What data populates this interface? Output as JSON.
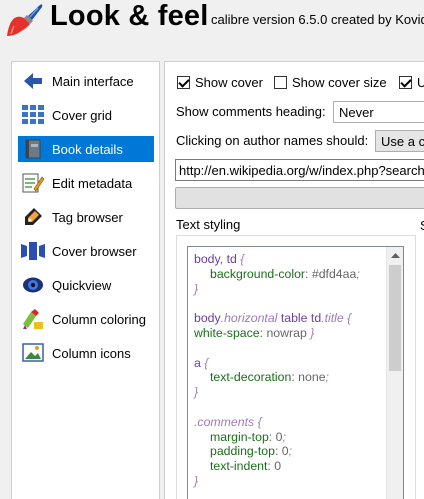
{
  "header": {
    "title": "Look & feel",
    "version": "calibre version 6.5.0 created by Kovid"
  },
  "sidebar": {
    "items": [
      {
        "label": "Main interface",
        "icon": "arrow-left-icon"
      },
      {
        "label": "Cover grid",
        "icon": "grid-icon"
      },
      {
        "label": "Book details",
        "icon": "book-icon",
        "selected": true
      },
      {
        "label": "Edit metadata",
        "icon": "edit-icon"
      },
      {
        "label": "Tag browser",
        "icon": "tag-icon"
      },
      {
        "label": "Cover browser",
        "icon": "cover-flow-icon"
      },
      {
        "label": "Quickview",
        "icon": "eye-icon"
      },
      {
        "label": "Column coloring",
        "icon": "palette-icon"
      },
      {
        "label": "Column icons",
        "icon": "image-icon"
      }
    ]
  },
  "book_details": {
    "show_cover_label": "Show cover",
    "show_cover_checked": true,
    "show_cover_size_label": "Show cover size",
    "show_cover_size_checked": false,
    "third_checkbox_label": "U",
    "third_checkbox_checked": true,
    "comments_heading_label": "Show comments heading:",
    "comments_heading_value": "Never",
    "author_click_label": "Clicking on author names should:",
    "author_click_value": "Use a c",
    "author_url": "http://en.wikipedia.org/w/index.php?search",
    "text_styling_label": "Text styling",
    "right_column_hint": "S"
  },
  "css_editor": {
    "lines": [
      [
        {
          "t": "body, td ",
          "c": "sel"
        },
        {
          "t": "{",
          "c": "brace"
        }
      ],
      [
        {
          "t": "background-color",
          "c": "prop",
          "ind": true
        },
        {
          "t": ": ",
          "c": "vl"
        },
        {
          "t": "#dfd4aa",
          "c": "vl"
        },
        {
          "t": ";",
          "c": "brace"
        }
      ],
      [
        {
          "t": "}",
          "c": "brace"
        }
      ],
      [
        {
          "t": "",
          "c": "vl"
        }
      ],
      [
        {
          "t": "body",
          "c": "sel"
        },
        {
          "t": ".horizontal",
          "c": "ital"
        },
        {
          "t": " table td",
          "c": "sel"
        },
        {
          "t": ".title",
          "c": "ital"
        },
        {
          "t": " {",
          "c": "brace"
        }
      ],
      [
        {
          "t": "white-space",
          "c": "prop"
        },
        {
          "t": ": nowrap ",
          "c": "vl"
        },
        {
          "t": "}",
          "c": "brace"
        }
      ],
      [
        {
          "t": "",
          "c": "vl"
        }
      ],
      [
        {
          "t": "a ",
          "c": "sel"
        },
        {
          "t": "{",
          "c": "brace"
        }
      ],
      [
        {
          "t": "text-decoration",
          "c": "prop",
          "ind": true
        },
        {
          "t": ": none",
          "c": "vl"
        },
        {
          "t": ";",
          "c": "brace"
        }
      ],
      [
        {
          "t": "}",
          "c": "brace"
        }
      ],
      [
        {
          "t": "",
          "c": "vl"
        }
      ],
      [
        {
          "t": ".comments ",
          "c": "ital"
        },
        {
          "t": "{",
          "c": "brace"
        }
      ],
      [
        {
          "t": "margin-top",
          "c": "prop",
          "ind": true
        },
        {
          "t": ": 0",
          "c": "vl"
        },
        {
          "t": ";",
          "c": "brace"
        }
      ],
      [
        {
          "t": "padding-top",
          "c": "prop",
          "ind": true
        },
        {
          "t": ": 0",
          "c": "vl"
        },
        {
          "t": ";",
          "c": "brace"
        }
      ],
      [
        {
          "t": "text-indent",
          "c": "prop",
          "ind": true
        },
        {
          "t": ": 0",
          "c": "vl"
        }
      ],
      [
        {
          "t": "}",
          "c": "brace"
        }
      ]
    ]
  },
  "colors": {
    "selection": "#0078d7",
    "selector": "#6a3fa0",
    "property": "#1b6e1b"
  }
}
